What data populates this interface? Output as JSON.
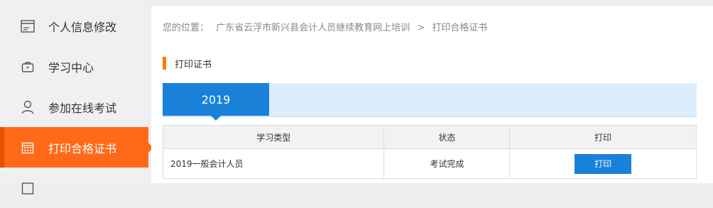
{
  "sidebar": {
    "items": [
      {
        "label": "个人信息修改",
        "icon": "id-card-icon",
        "active": false
      },
      {
        "label": "学习中心",
        "icon": "briefcase-icon",
        "active": false
      },
      {
        "label": "参加在线考试",
        "icon": "user-icon",
        "active": false
      },
      {
        "label": "打印合格证书",
        "icon": "calendar-icon",
        "active": true
      },
      {
        "label": "",
        "icon": "document-icon",
        "active": false
      }
    ]
  },
  "breadcrumb": {
    "prefix": "您的位置：",
    "site": "广东省云浮市新兴县会计人员继续教育网上培训",
    "separator": ">",
    "current": "打印合格证书"
  },
  "section": {
    "title": "打印证书"
  },
  "year_tab": {
    "label": "2019"
  },
  "table": {
    "headers": [
      "学习类型",
      "状态",
      "打印"
    ],
    "rows": [
      {
        "type": "2019一般会计人员",
        "status": "考试完成",
        "action_label": "打印"
      }
    ]
  },
  "colors": {
    "accent_orange": "#ff6a1a",
    "accent_blue": "#1a81d8",
    "strip_blue": "#dcedfc"
  }
}
